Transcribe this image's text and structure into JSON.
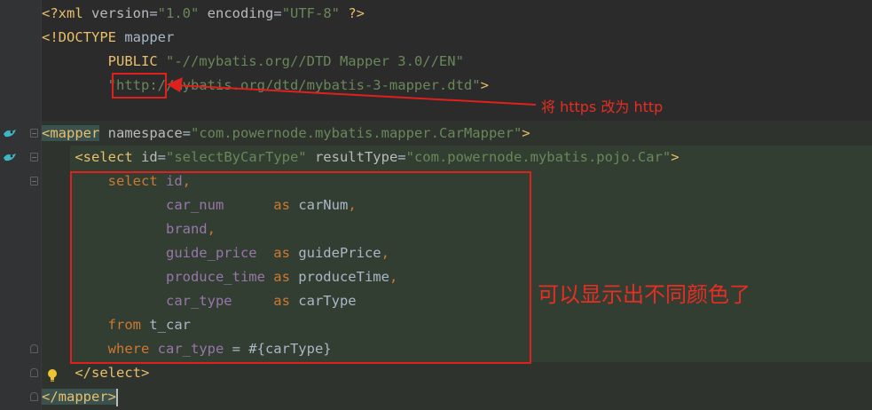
{
  "code": {
    "l1": {
      "p1": "<?xml ",
      "p2": "version",
      "p3": "=",
      "p4": "\"1.0\"",
      "p5": " encoding",
      "p6": "=",
      "p7": "\"UTF-8\"",
      "p8": " ?>"
    },
    "l2": {
      "p1": "<!DOCTYPE ",
      "p2": "mapper"
    },
    "l3": {
      "p1": "        PUBLIC ",
      "p2": "\"-//mybatis.org//DTD Mapper 3.0//EN\""
    },
    "l4": {
      "p1": "        ",
      "p2": "\"http://mybatis.org/dtd/mybatis-3-mapper.dtd\"",
      "p3": ">"
    },
    "l5": {
      "p1": "<mapper",
      "p2": " namespace",
      "p3": "=",
      "p4": "\"com.powernode.mybatis.mapper.CarMapper\"",
      "p5": ">"
    },
    "l6": {
      "p1": "    <select",
      "p2": " id",
      "p3": "=",
      "p4": "\"selectByCarType\"",
      "p5": " resultType",
      "p6": "=",
      "p7": "\"com.powernode.mybatis.pojo.Car\"",
      "p8": ">"
    },
    "l7": {
      "p1": "        select ",
      "p2": "id",
      "p3": ","
    },
    "l8": {
      "p1": "               ",
      "p2": "car_num",
      "p3": "      as ",
      "p4": "carNum",
      "p5": ","
    },
    "l9": {
      "p1": "               ",
      "p2": "brand",
      "p3": ","
    },
    "l10": {
      "p1": "               ",
      "p2": "guide_price",
      "p3": "  as ",
      "p4": "guidePrice",
      "p5": ","
    },
    "l11": {
      "p1": "               ",
      "p2": "produce_time",
      "p3": " as ",
      "p4": "produceTime",
      "p5": ","
    },
    "l12": {
      "p1": "               ",
      "p2": "car_type",
      "p3": "     as ",
      "p4": "carType"
    },
    "l13": {
      "p1": "        from ",
      "p2": "t_car"
    },
    "l14": {
      "p1": "        where ",
      "p2": "car_type",
      "p3": " = #{carType}"
    },
    "l15": {
      "p1": "    </select>"
    },
    "l16": {
      "p1": "</mapper",
      "p2": ">"
    }
  },
  "annotations": {
    "https_note": "将 https 改为 http",
    "color_note": "可以显示出不同颜色了"
  },
  "colors": {
    "background": "#2b2b2b",
    "tag": "#e8bf6a",
    "string": "#6a8759",
    "keyword": "#cc7832",
    "field": "#9876aa",
    "annotation": "#e82d22"
  },
  "icons": {
    "gutter_mapper": "mybatis-mapper-icon",
    "gutter_select": "mybatis-statement-icon",
    "bulb": "lightbulb-icon"
  }
}
